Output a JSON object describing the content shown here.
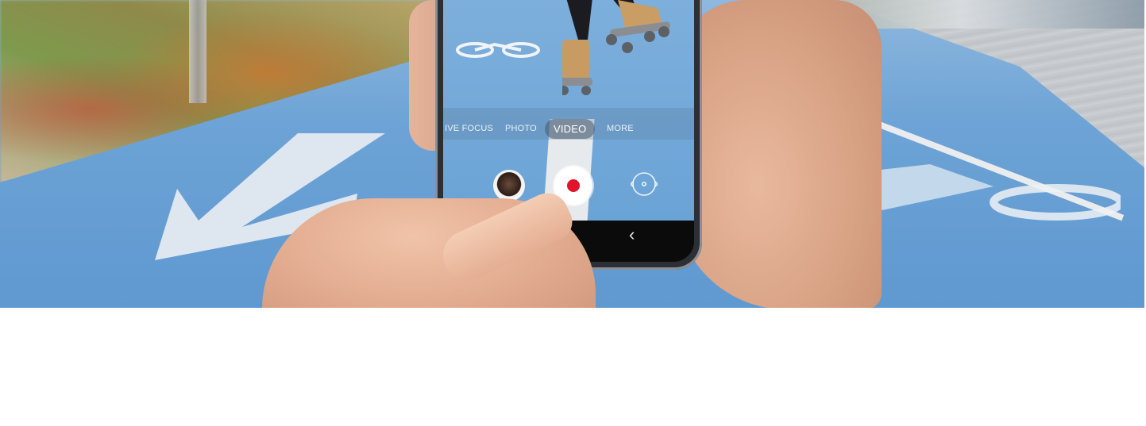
{
  "camera": {
    "modes": {
      "live_focus": "IVE FOCUS",
      "photo": "PHOTO",
      "video": "VIDEO",
      "more": "MORE"
    },
    "selected_mode": "VIDEO",
    "record_color": "#e0142b"
  },
  "navbar": {
    "back_glyph": "‹"
  },
  "colors": {
    "lane_blue": "#6aa3d6",
    "background": "#ffffff"
  },
  "icons": [
    "record-icon",
    "switch-camera-icon",
    "home-icon",
    "back-icon",
    "gallery-thumbnail"
  ]
}
